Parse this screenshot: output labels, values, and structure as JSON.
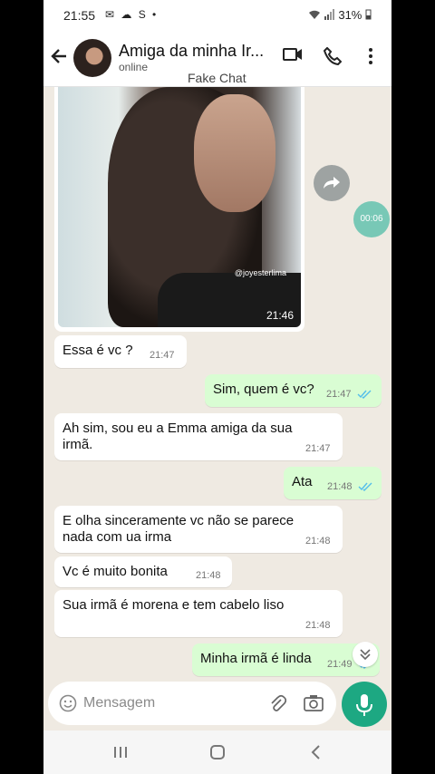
{
  "status_bar": {
    "time": "21:55",
    "icons": "✉ ☁ S •",
    "battery": "31%"
  },
  "header": {
    "contact_name": "Amiga da minha Ir...",
    "status": "online",
    "watermark": "Fake Chat"
  },
  "photo_message": {
    "credit": "@joyesterlima",
    "time": "21:46"
  },
  "video_badge": "00:06",
  "messages": [
    {
      "dir": "in",
      "text": "Essa é vc ?",
      "time": "21:47"
    },
    {
      "dir": "out",
      "text": "Sim, quem é vc?",
      "time": "21:47"
    },
    {
      "dir": "in",
      "text_line1": "Ah sim, sou eu a Emma amiga da sua",
      "text_line2": "irmã.",
      "time": "21:47"
    },
    {
      "dir": "out",
      "text": "Ata",
      "time": "21:48"
    },
    {
      "dir": "in",
      "text_line1": "E olha sinceramente vc não se parece",
      "text_line2": "nada com ua irma",
      "time": "21:48"
    },
    {
      "dir": "in",
      "text": "Vc é muito bonita",
      "time": "21:48"
    },
    {
      "dir": "in",
      "text": "Sua irmã é morena e tem cabelo liso",
      "time": "21:48"
    },
    {
      "dir": "out",
      "text": "Minha irmã é linda",
      "time": "21:49"
    }
  ],
  "composer": {
    "placeholder": "Mensagem"
  },
  "colors": {
    "accent": "#1da882",
    "outgoing_bubble": "#d9fdd3",
    "incoming_bubble": "#ffffff",
    "chat_bg": "#efeae2",
    "read_ticks": "#53bdeb"
  }
}
